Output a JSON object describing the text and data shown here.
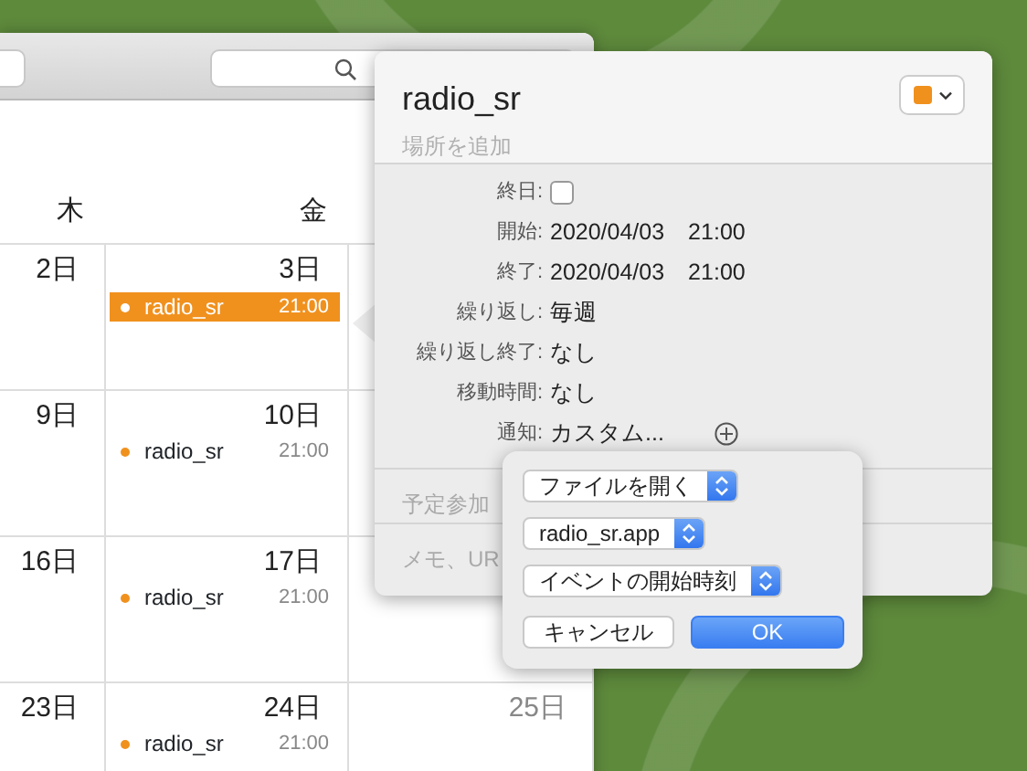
{
  "calendar": {
    "weekdays": [
      "木",
      "金"
    ],
    "weeks": [
      {
        "days": [
          {
            "date": "2日",
            "dimmed": false
          },
          {
            "date": "3日",
            "dimmed": false,
            "events": [
              {
                "title": "radio_sr",
                "time": "21:00",
                "selected": true
              }
            ]
          }
        ]
      },
      {
        "days": [
          {
            "date": "9日",
            "dimmed": false
          },
          {
            "date": "10日",
            "dimmed": false,
            "events": [
              {
                "title": "radio_sr",
                "time": "21:00",
                "selected": false
              }
            ]
          }
        ]
      },
      {
        "days": [
          {
            "date": "16日",
            "dimmed": false
          },
          {
            "date": "17日",
            "dimmed": false,
            "events": [
              {
                "title": "radio_sr",
                "time": "21:00",
                "selected": false
              }
            ]
          }
        ]
      },
      {
        "days": [
          {
            "date": "23日",
            "dimmed": false
          },
          {
            "date": "24日",
            "dimmed": false,
            "events": [
              {
                "title": "radio_sr",
                "time": "21:00",
                "selected": false
              }
            ]
          },
          {
            "date": "25日",
            "dimmed": true
          }
        ]
      }
    ]
  },
  "event_popover": {
    "title": "radio_sr",
    "location_placeholder": "場所を追加",
    "color": "#f0911e",
    "fields": [
      {
        "kind": "checkbox",
        "label": "終日:",
        "checked": false
      },
      {
        "kind": "text",
        "label": "開始:",
        "value": "2020/04/03　21:00"
      },
      {
        "kind": "text",
        "label": "終了:",
        "value": "2020/04/03　21:00"
      },
      {
        "kind": "text",
        "label": "繰り返し:",
        "value": "毎週"
      },
      {
        "kind": "text",
        "label": "繰り返し終了:",
        "value": "なし"
      },
      {
        "kind": "text",
        "label": "移動時間:",
        "value": "なし"
      },
      {
        "kind": "alert",
        "label": "通知:",
        "value": "カスタム..."
      }
    ],
    "invitees_placeholder": "予定参加",
    "notes_placeholder": "メモ、UR"
  },
  "alert_popover": {
    "menus": [
      "ファイルを開く",
      "radio_sr.app",
      "イベントの開始時刻"
    ],
    "cancel": "キャンセル",
    "ok": "OK"
  }
}
